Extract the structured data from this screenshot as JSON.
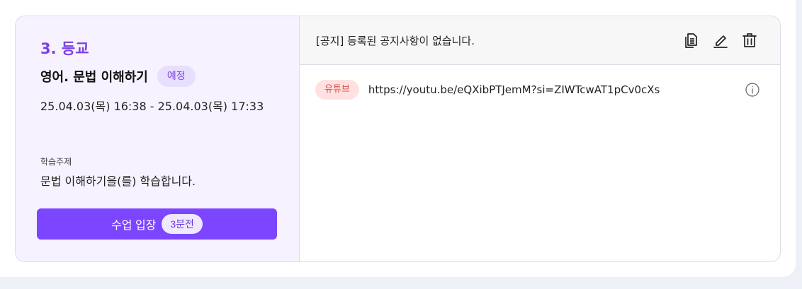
{
  "lesson": {
    "period": "3. 등교",
    "subject": "영어. 문법 이해하기",
    "status": "예정",
    "datetime": "25.04.03(목) 16:38 - 25.04.03(목) 17:33",
    "topic_label": "학습주제",
    "topic_text": "문법 이해하기을(를) 학습합니다.",
    "enter_button": {
      "label": "수업 입장",
      "countdown": "3분전"
    }
  },
  "notice": {
    "text": "[공지] 등록된 공지사항이 없습니다.",
    "icons": [
      "copy-icon",
      "edit-icon",
      "trash-icon"
    ]
  },
  "links": [
    {
      "badge": "유튜브",
      "url": "https://youtu.be/eQXibPTJemM?si=ZIWTcwAT1pCv0cXs"
    }
  ],
  "colors": {
    "accent": "#7c45ff",
    "period": "#7b3fe4",
    "left_panel_bg": "#f6f2ff",
    "youtube_badge_bg": "#ffe1e1",
    "youtube_badge_text": "#e04a4a"
  }
}
